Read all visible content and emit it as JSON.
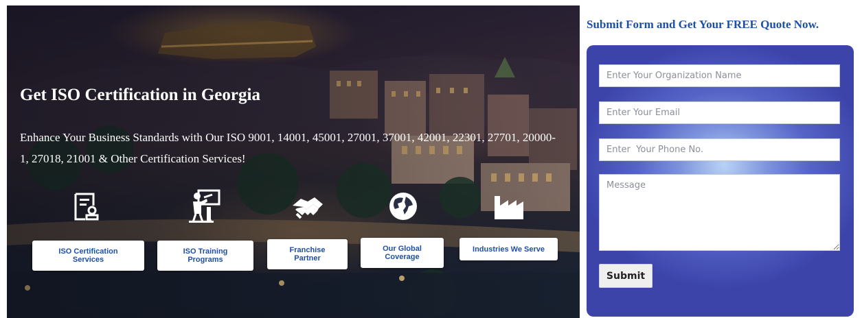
{
  "hero": {
    "title": "Get ISO Certification in Georgia",
    "subtitle": "Enhance Your Business Standards with Our ISO 9001, 14001, 45001, 27001, 37001, 42001, 22301, 27701, 20000-1, 27018, 21001 & Other Certification Services!",
    "services": [
      {
        "label_line1": "ISO Certification",
        "label_line2": "Services",
        "icon": "certificate-icon"
      },
      {
        "label_line1": "ISO Training",
        "label_line2": "Programs",
        "icon": "training-presenter-icon"
      },
      {
        "label_line1": "Franchise",
        "label_line2": "Partner",
        "icon": "handshake-icon"
      },
      {
        "label_line1": "Our Global",
        "label_line2": "Coverage",
        "icon": "globe-icon"
      },
      {
        "label_line1": "Industries We Serve",
        "label_line2": "",
        "icon": "factory-icon"
      }
    ]
  },
  "form": {
    "heading": "Submit Form and Get Your FREE Quote Now.",
    "org_placeholder": "Enter Your Organization Name",
    "email_placeholder": "Enter Your Email",
    "phone_placeholder": "Enter  Your Phone No.",
    "message_placeholder": "Message",
    "submit_label": "Submit"
  },
  "colors": {
    "accent_text": "#1c4fa6",
    "form_panel": "#4a55bb",
    "button_text": "#1f4ea3"
  }
}
